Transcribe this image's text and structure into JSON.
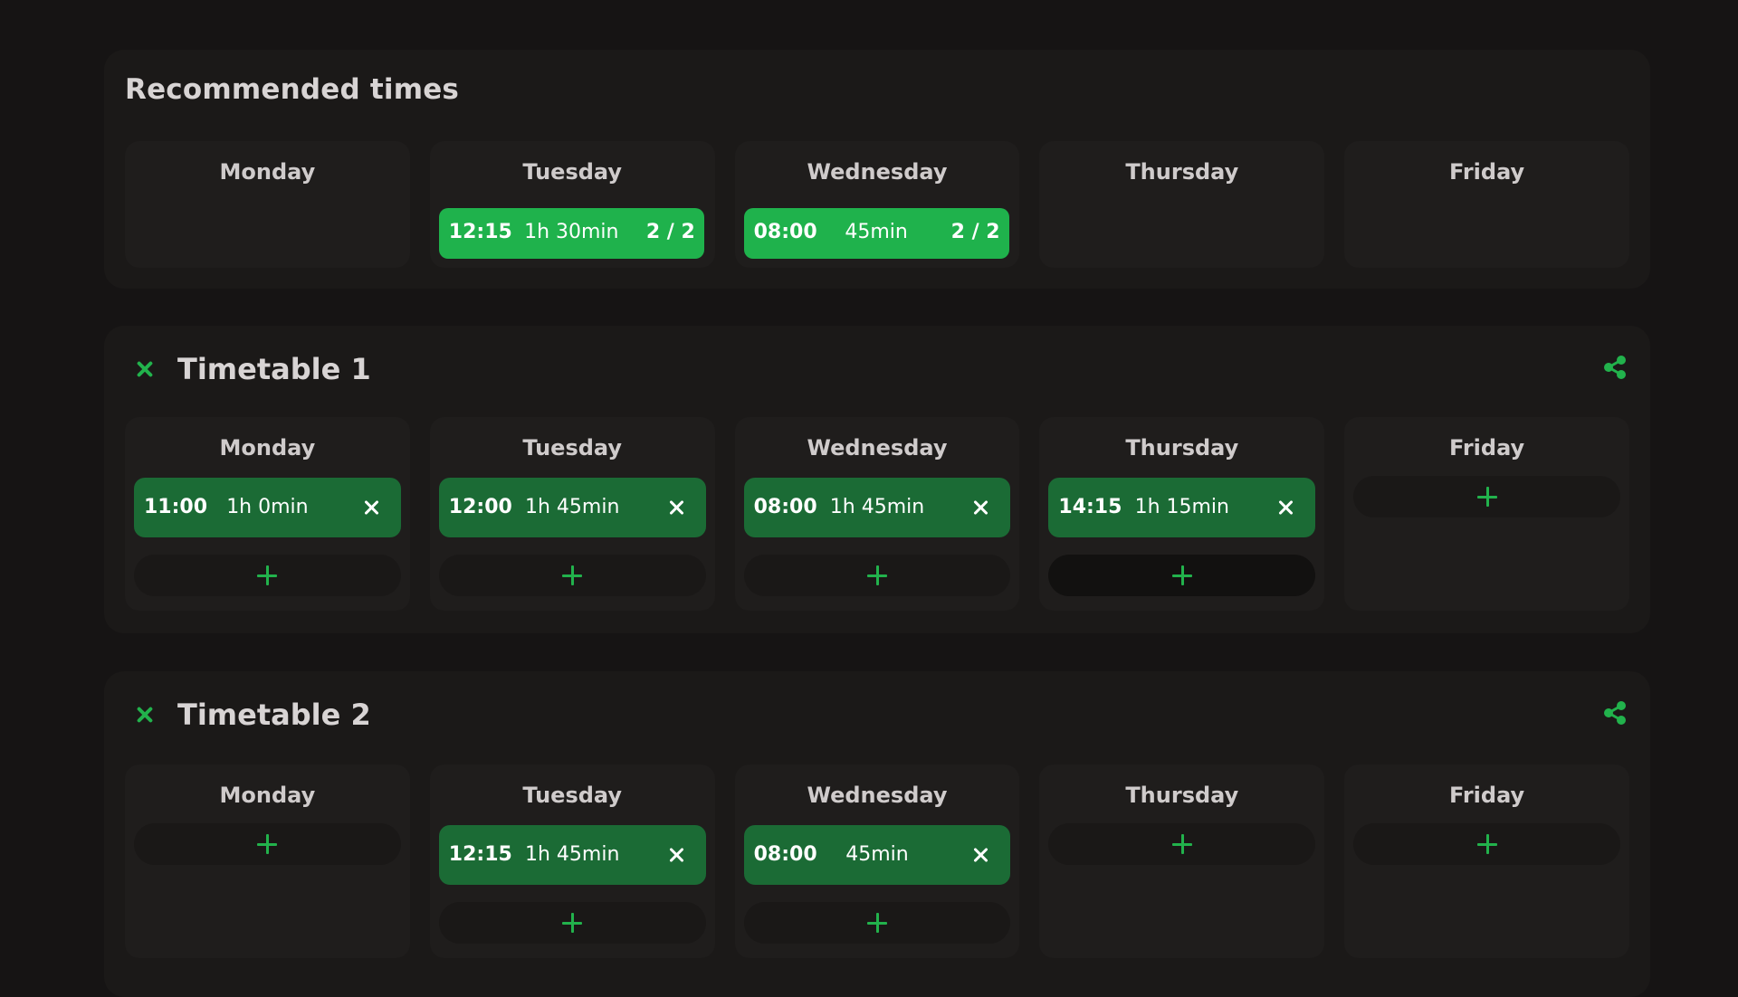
{
  "recommended": {
    "title": "Recommended times",
    "days": [
      {
        "name": "Monday",
        "slots": []
      },
      {
        "name": "Tuesday",
        "slots": [
          {
            "time": "12:15",
            "duration": "1h 30min",
            "count": "2 / 2"
          }
        ]
      },
      {
        "name": "Wednesday",
        "slots": [
          {
            "time": "08:00",
            "duration": "45min",
            "count": "2 / 2"
          }
        ]
      },
      {
        "name": "Thursday",
        "slots": []
      },
      {
        "name": "Friday",
        "slots": []
      }
    ]
  },
  "timetables": [
    {
      "title": "Timetable 1",
      "days": [
        {
          "name": "Monday",
          "slots": [
            {
              "time": "11:00",
              "duration": "1h 0min"
            }
          ]
        },
        {
          "name": "Tuesday",
          "slots": [
            {
              "time": "12:00",
              "duration": "1h 45min"
            }
          ]
        },
        {
          "name": "Wednesday",
          "slots": [
            {
              "time": "08:00",
              "duration": "1h 45min"
            }
          ]
        },
        {
          "name": "Thursday",
          "slots": [
            {
              "time": "14:15",
              "duration": "1h 15min"
            }
          ]
        },
        {
          "name": "Friday",
          "slots": []
        }
      ]
    },
    {
      "title": "Timetable 2",
      "days": [
        {
          "name": "Monday",
          "slots": []
        },
        {
          "name": "Tuesday",
          "slots": [
            {
              "time": "12:15",
              "duration": "1h 45min"
            }
          ]
        },
        {
          "name": "Wednesday",
          "slots": [
            {
              "time": "08:00",
              "duration": "45min"
            }
          ]
        },
        {
          "name": "Thursday",
          "slots": []
        },
        {
          "name": "Friday",
          "slots": []
        }
      ]
    }
  ],
  "icons": {
    "remove_timetable": "close-icon",
    "share": "share-icon",
    "add_slot": "plus-icon",
    "remove_slot": "close-icon"
  },
  "colors": {
    "accent": "#22b24c",
    "recommended_slot": "#1fb24c",
    "slot": "#1b6b35",
    "background": "#161414",
    "panel": "#1b1918",
    "day_card": "#1f1d1c"
  }
}
